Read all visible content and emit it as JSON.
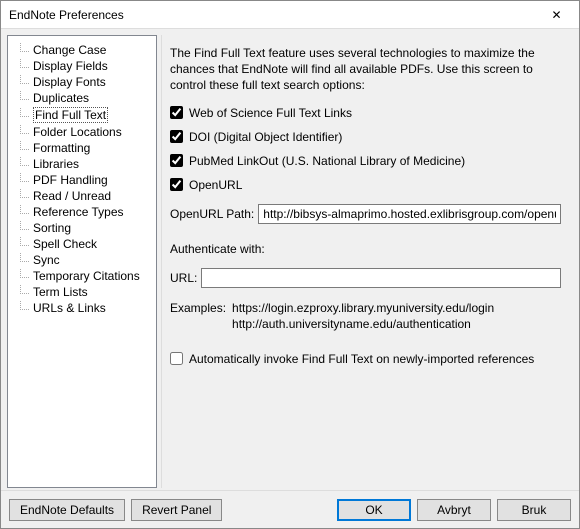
{
  "window": {
    "title": "EndNote Preferences",
    "close_glyph": "✕"
  },
  "tree": {
    "items": [
      "Change Case",
      "Display Fields",
      "Display Fonts",
      "Duplicates",
      "Find Full Text",
      "Folder Locations",
      "Formatting",
      "Libraries",
      "PDF Handling",
      "Read / Unread",
      "Reference Types",
      "Sorting",
      "Spell Check",
      "Sync",
      "Temporary Citations",
      "Term Lists",
      "URLs & Links"
    ],
    "selected_index": 4
  },
  "panel": {
    "description": "The Find Full Text feature uses several technologies to maximize the chances that EndNote will find all available PDFs. Use this screen to control these full text search options:",
    "checks": {
      "wos": {
        "label": "Web of Science Full Text Links",
        "checked": true
      },
      "doi": {
        "label": "DOI (Digital Object Identifier)",
        "checked": true
      },
      "pubmed": {
        "label": "PubMed LinkOut (U.S. National Library of Medicine)",
        "checked": true
      },
      "openurl": {
        "label": "OpenURL",
        "checked": true
      }
    },
    "openurl_path": {
      "label": "OpenURL Path:",
      "value": "http://bibsys-almaprimo.hosted.exlibrisgroup.com/openu"
    },
    "authenticate_label": "Authenticate with:",
    "url_row": {
      "label": "URL:",
      "value": ""
    },
    "examples": {
      "label": "Examples:",
      "line1": "https://login.ezproxy.library.myuniversity.edu/login",
      "line2": "http://auth.universityname.edu/authentication"
    },
    "auto_invoke": {
      "label": "Automatically invoke Find Full Text on newly-imported references",
      "checked": false
    }
  },
  "footer": {
    "defaults": "EndNote Defaults",
    "revert": "Revert Panel",
    "ok": "OK",
    "cancel": "Avbryt",
    "apply": "Bruk"
  }
}
